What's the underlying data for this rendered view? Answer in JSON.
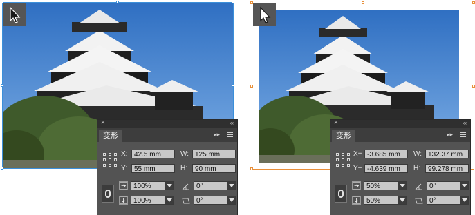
{
  "colors": {
    "sky": "#3a7ac8",
    "left_selection": "#3b8fd9",
    "right_selection": "#e8903a",
    "panel_bg": "#535353",
    "field_bg": "#c8c8c8"
  },
  "panels": [
    {
      "tab_label": "変形",
      "close_glyph": "×",
      "collapse_glyph": "‹‹",
      "flyout_glyph": "▸▸",
      "x_label": "X:",
      "y_label": "Y:",
      "w_label": "W:",
      "h_label": "H:",
      "x_value": "42.5 mm",
      "y_value": "55 mm",
      "w_value": "125 mm",
      "h_value": "90 mm",
      "scale_x": "100%",
      "scale_y": "100%",
      "rotate": "0°",
      "shear": "0°"
    },
    {
      "tab_label": "変形",
      "close_glyph": "×",
      "collapse_glyph": "‹‹",
      "flyout_glyph": "▸▸",
      "x_label": "X+",
      "y_label": "Y+",
      "w_label": "W:",
      "h_label": "H:",
      "x_value": "-3.685 mm",
      "y_value": "-4.639 mm",
      "w_value": "132.37 mm",
      "h_value": "99.278 mm",
      "scale_x": "50%",
      "scale_y": "50%",
      "rotate": "0°",
      "shear": "0°"
    }
  ],
  "icons": {
    "cursor_left": "selection-tool-cursor",
    "cursor_right": "direct-selection-cursor",
    "reference_point": "reference-point-grid",
    "constrain": "chain-link-icon",
    "scale_x_icon": "scale-x-icon",
    "scale_y_icon": "scale-y-icon",
    "rotate_icon": "rotate-angle-icon",
    "shear_icon": "shear-icon"
  }
}
